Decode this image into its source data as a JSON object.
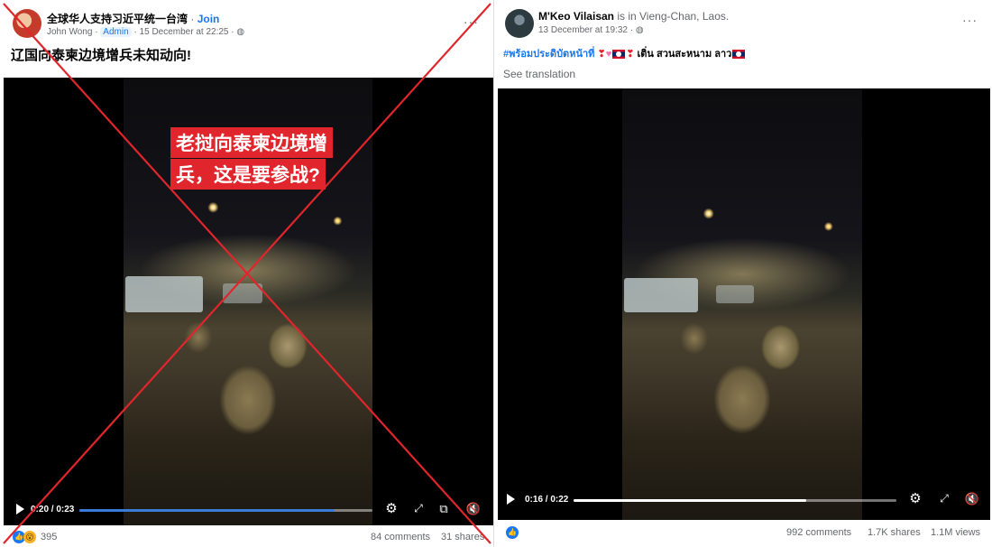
{
  "left_post": {
    "group_name": "全球华人支持习近平统一台湾",
    "join_label": "Join",
    "author": "John Wong",
    "author_badge": "Admin",
    "timestamp": "15 December at 22:25",
    "caption": "辽国向泰柬边境增兵未知动向!",
    "overlay_line1": "老挝向泰柬边境增",
    "overlay_line2": "兵，这是要参战?",
    "video_time": "0:20 / 0:23",
    "progress_fraction": 0.87,
    "reaction_count": "395",
    "comments": "84 comments",
    "shares": "31 shares",
    "crossed_out": true,
    "cross_color": "#e0262c"
  },
  "right_post": {
    "author": "M'Keo Vilaisan",
    "location_text": "is in Vieng-Chan, Laos.",
    "timestamp": "13 December at 19:32",
    "caption_hashtag": "#พร้อมประดิบัตหน้าที่",
    "caption_tail": "เติ่น สวนสะหนาม ลาว",
    "see_translation": "See translation",
    "video_time": "0:16 / 0:22",
    "progress_fraction": 0.72,
    "comments": "992 comments",
    "shares": "1.7K shares",
    "views": "1.1M views"
  },
  "icons": {
    "play": "play-icon",
    "settings": "gear-icon",
    "expand": "expand-icon",
    "pip": "picture-in-picture-icon",
    "volume": "mute-icon",
    "globe": "globe-icon",
    "more": "more-dots-icon",
    "like": "like-reaction-icon"
  },
  "colors": {
    "facebook_blue": "#1877f2",
    "overlay_red": "#e0262c",
    "secondary_text": "#65676b"
  }
}
